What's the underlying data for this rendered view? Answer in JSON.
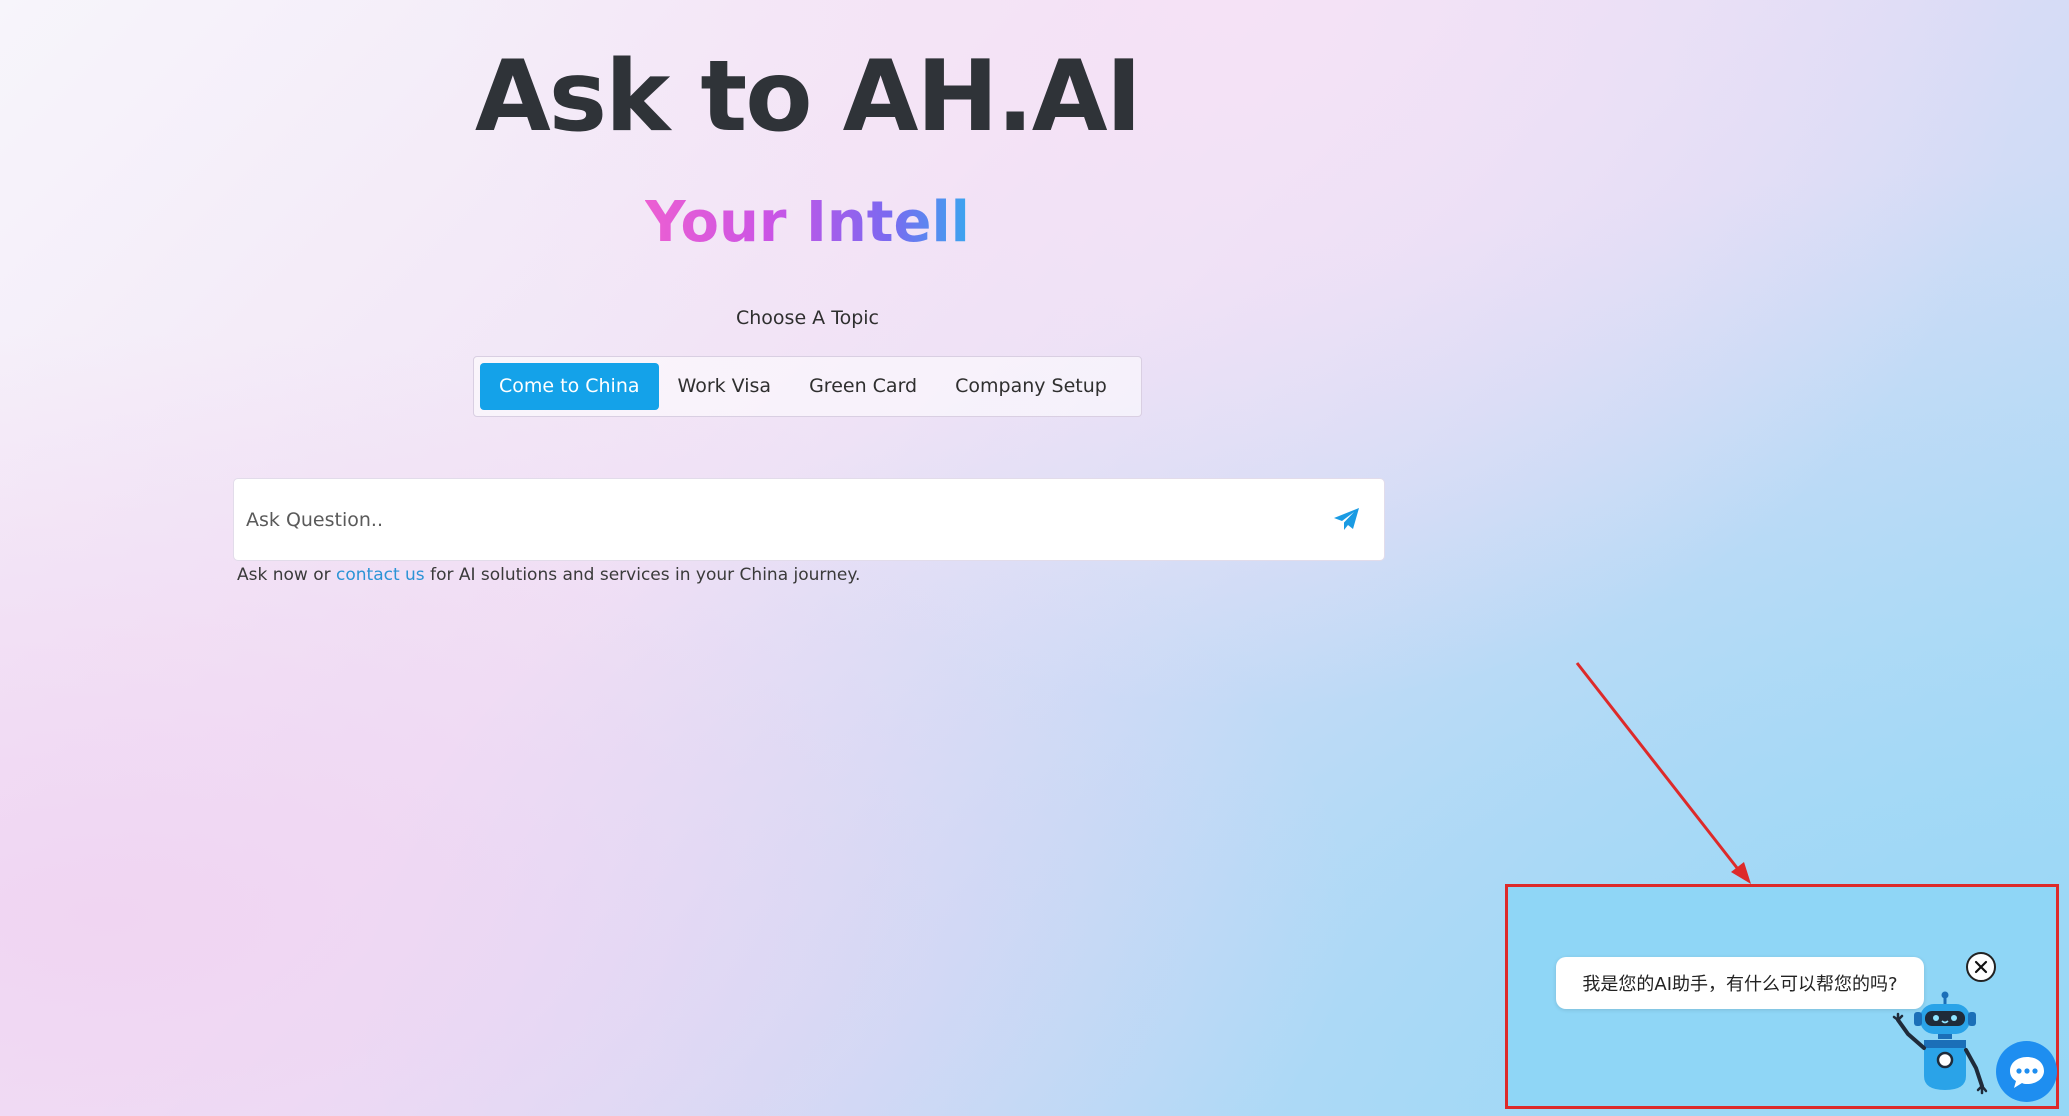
{
  "hero": {
    "title": "Ask to AH.AI",
    "subtitle": "Your Intell"
  },
  "topics": {
    "label": "Choose A Topic",
    "tabs": [
      {
        "label": "Come to China",
        "active": true
      },
      {
        "label": "Work Visa",
        "active": false
      },
      {
        "label": "Green Card",
        "active": false
      },
      {
        "label": "Company Setup",
        "active": false
      }
    ]
  },
  "ask": {
    "placeholder": "Ask Question..",
    "send_icon": "paper-plane-icon"
  },
  "helper": {
    "prefix": "Ask now or",
    "link": "contact us",
    "suffix": "for AI solutions and services in your China journey."
  },
  "chat_widget": {
    "greeting": "我是您的AI助手，有什么可以帮您的吗?",
    "close_icon": "close-icon",
    "mascot": "robot-mascot",
    "launcher_icon": "chat-bubble-icon"
  },
  "colors": {
    "accent": "#14a2e9",
    "annotation": "#dd2a2a",
    "launcher": "#1e8ef0"
  }
}
